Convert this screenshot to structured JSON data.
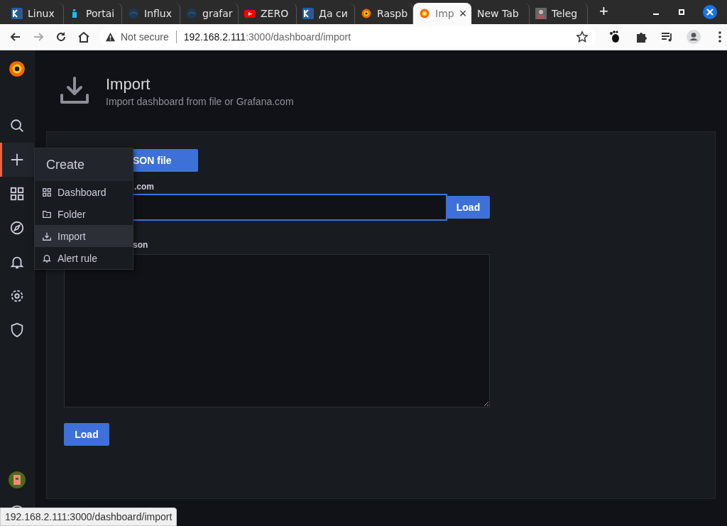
{
  "browser": {
    "tabs": [
      {
        "title": "Linux",
        "kind": "k",
        "selected": false
      },
      {
        "title": "Portai",
        "kind": "docker",
        "selected": false
      },
      {
        "title": "Influx",
        "kind": "globe",
        "selected": false
      },
      {
        "title": "grafar",
        "kind": "globe",
        "selected": false
      },
      {
        "title": "ZERO",
        "kind": "youtube",
        "selected": false
      },
      {
        "title": "Да си",
        "kind": "k",
        "selected": false
      },
      {
        "title": "Raspb",
        "kind": "grafana",
        "selected": false
      },
      {
        "title": "Imp",
        "kind": "grafana",
        "selected": true
      },
      {
        "title": "New Tab",
        "kind": "blank",
        "selected": false
      },
      {
        "title": "Teleg",
        "kind": "photo",
        "selected": false
      }
    ],
    "new_tab": "+",
    "close_tab": "×",
    "security": "Not secure",
    "url_host": "192.168.2.111",
    "url_path": ":3000/dashboard/import"
  },
  "page": {
    "title": "Import",
    "subtitle": "Import dashboard from file or Grafana.com",
    "upload_button": "SON file",
    "grafana_label": ".com",
    "load_button": "Load",
    "json_label": "son",
    "load_json_button": "Load"
  },
  "create_menu": {
    "title": "Create",
    "items": [
      {
        "label": "Dashboard",
        "kind": "grid",
        "selected": false
      },
      {
        "label": "Folder",
        "kind": "folder",
        "selected": false
      },
      {
        "label": "Import",
        "kind": "import",
        "selected": true
      },
      {
        "label": "Alert rule",
        "kind": "bell",
        "selected": false
      }
    ]
  },
  "sidebar": {
    "items": [
      {
        "kind": "search",
        "selected": false
      },
      {
        "kind": "plus",
        "selected": true
      },
      {
        "kind": "grid",
        "selected": false
      },
      {
        "kind": "compass",
        "selected": false
      },
      {
        "kind": "bell",
        "selected": false
      },
      {
        "kind": "gear",
        "selected": false
      },
      {
        "kind": "shield",
        "selected": false
      }
    ]
  },
  "status_bubble": "192.168.2.111:3000/dashboard/import"
}
